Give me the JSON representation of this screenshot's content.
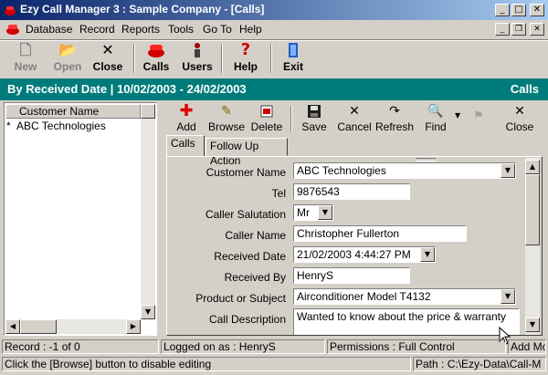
{
  "window": {
    "title": "Ezy Call Manager 3 : Sample Company  - [Calls]",
    "controls": {
      "minimize": "_",
      "maximize": "□",
      "close": "✕"
    }
  },
  "menu": {
    "items": [
      "Database",
      "Record",
      "Reports",
      "Tools",
      "Go To",
      "Help"
    ]
  },
  "toolbar": {
    "new": "New",
    "open": "Open",
    "close": "Close",
    "calls": "Calls",
    "users": "Users",
    "help": "Help",
    "exit": "Exit"
  },
  "band": {
    "title": "By Received Date | 10/02/2003 - 24/02/2003",
    "module": "Calls"
  },
  "grid": {
    "column": "Customer Name",
    "rows": [
      {
        "marker": "*",
        "name": "ABC Technologies"
      }
    ]
  },
  "record_toolbar": {
    "add": "Add",
    "browse": "Browse",
    "delete": "Delete",
    "save": "Save",
    "cancel": "Cancel",
    "refresh": "Refresh",
    "find": "Find",
    "close": "Close"
  },
  "tabs": [
    "Calls",
    "Follow Up Action"
  ],
  "form": {
    "customer_name": {
      "label": "Customer Name",
      "value": "ABC Technologies"
    },
    "tel": {
      "label": "Tel",
      "value": "9876543"
    },
    "salutation": {
      "label": "Caller Salutation",
      "value": "Mr"
    },
    "caller_name": {
      "label": "Caller Name",
      "value": "Christopher Fullerton"
    },
    "received_date": {
      "label": "Received Date",
      "value": "21/02/2003 4:44:27 PM"
    },
    "received_by": {
      "label": "Received By",
      "value": "HenryS"
    },
    "product": {
      "label": "Product or Subject",
      "value": "Airconditioner Model T4132"
    },
    "description": {
      "label": "Call Description",
      "value": "Wanted to know about the price & warranty"
    }
  },
  "status": {
    "record": "Record : -1 of 0",
    "logged_on": "Logged on as : HenryS",
    "permissions": "Permissions : Full Control",
    "mode": "Add Mo",
    "hint": "Click the [Browse] button to disable editing",
    "path": "Path : C:\\Ezy-Data\\Call-M"
  },
  "colors": {
    "band": "#007b7b",
    "titlebar_start": "#0a246a",
    "titlebar_end": "#a6caf0"
  }
}
